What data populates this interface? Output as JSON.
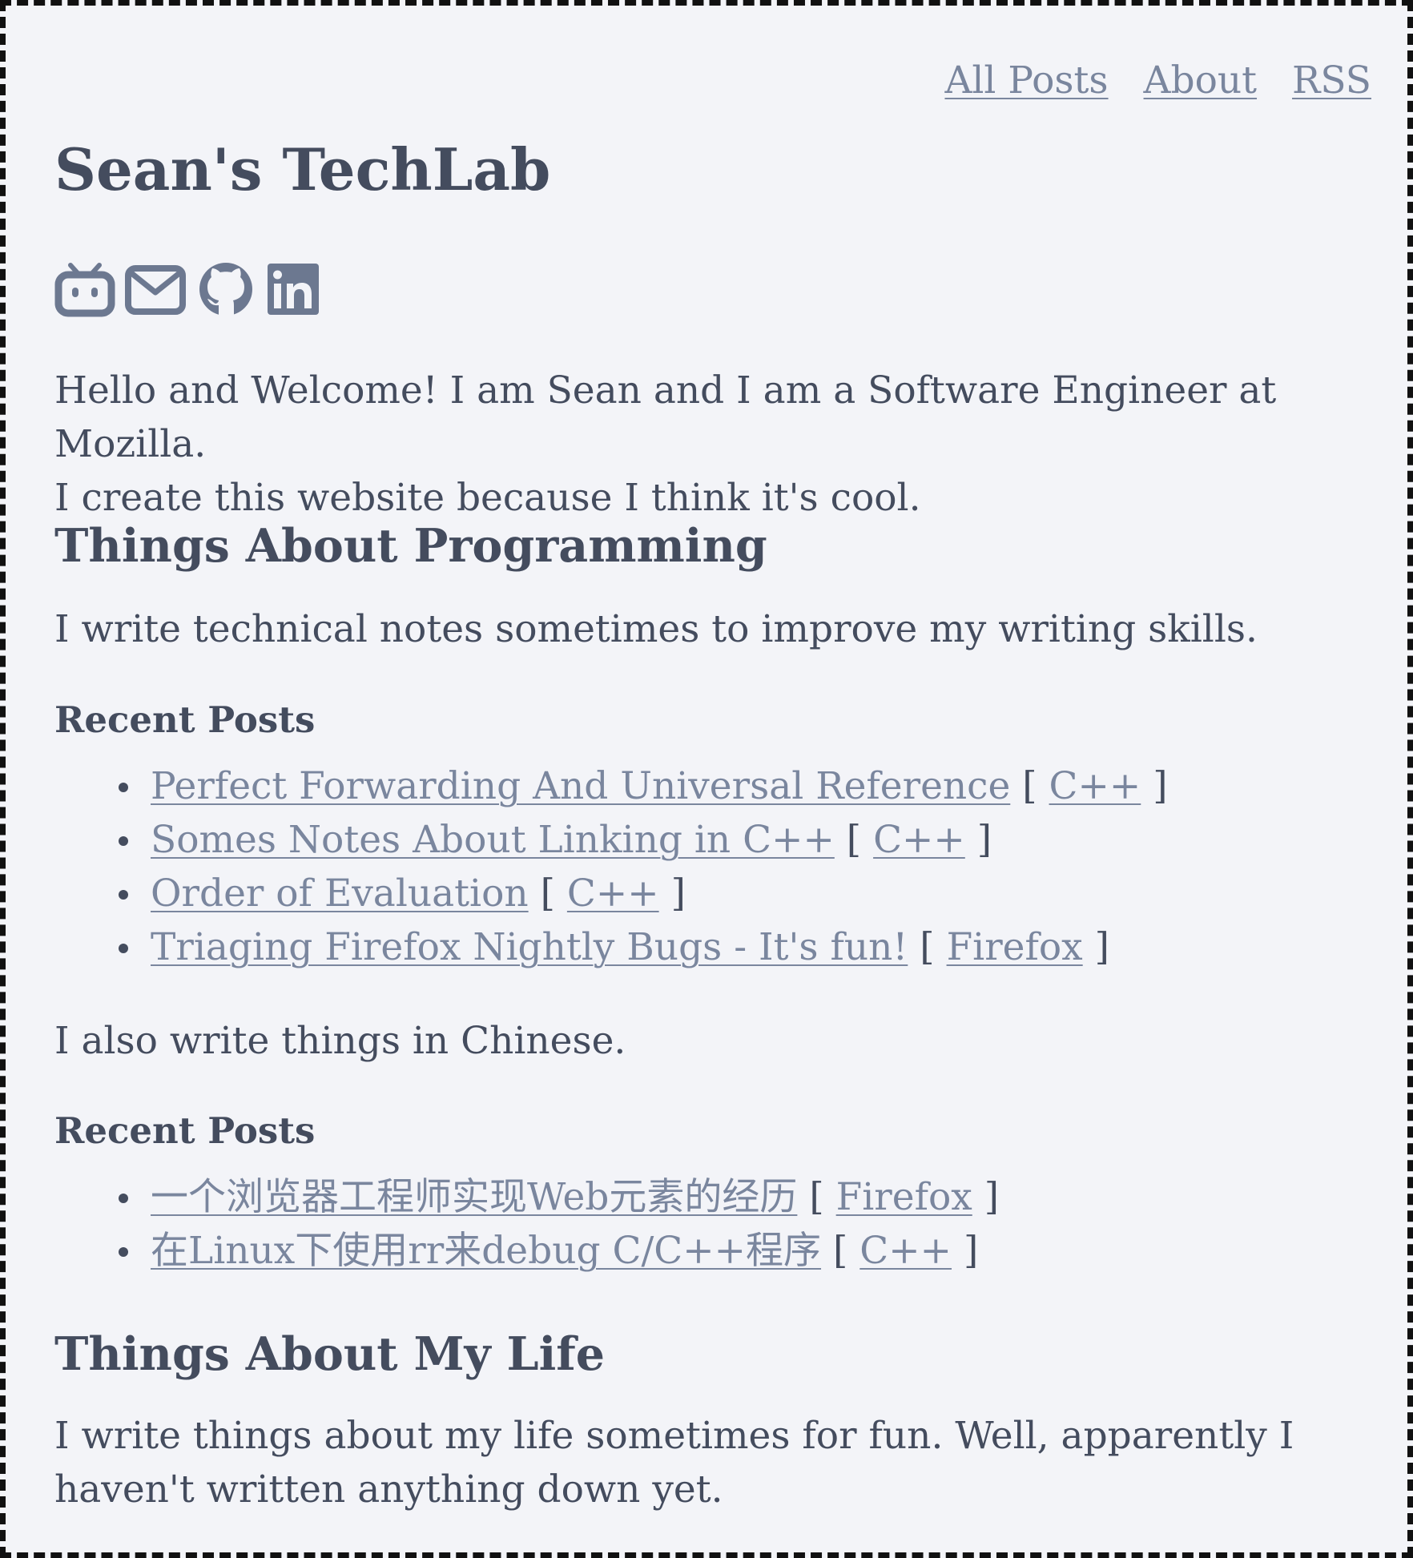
{
  "nav": {
    "all_posts": "All Posts",
    "about": "About",
    "rss": "RSS"
  },
  "site": {
    "title": "Sean's TechLab"
  },
  "social_icons": [
    "bilibili-icon",
    "email-icon",
    "github-icon",
    "linkedin-icon"
  ],
  "intro": {
    "line1": "Hello and Welcome! I am Sean and I am a Software Engineer at Mozilla.",
    "line2": "I create this website because I think it's cool."
  },
  "programming": {
    "heading": "Things About Programming",
    "description": "I write technical notes sometimes to improve my writing skills.",
    "recent_heading": "Recent Posts",
    "posts": [
      {
        "title": "Perfect Forwarding And Universal Reference",
        "tag": "C++"
      },
      {
        "title": "Somes Notes About Linking in C++",
        "tag": "C++"
      },
      {
        "title": "Order of Evaluation",
        "tag": "C++"
      },
      {
        "title": "Triaging Firefox Nightly Bugs - It's fun!",
        "tag": "Firefox"
      }
    ],
    "chinese_note": "I also write things in Chinese.",
    "chinese_recent_heading": "Recent Posts",
    "chinese_posts": [
      {
        "title": "一个浏览器工程师实现Web元素的经历",
        "tag": "Firefox"
      },
      {
        "title": "在Linux下使用rr来debug C/C++程序",
        "tag": "C++"
      }
    ]
  },
  "life": {
    "heading": "Things About My Life",
    "line1": "I write things about my life sometimes for fun. Well, apparently I",
    "line2": "haven't written anything down yet."
  },
  "colors": {
    "background": "#f3f4f8",
    "text": "#444c5e",
    "link": "#7a869e",
    "icon": "#6c7890",
    "border": "#111111"
  }
}
